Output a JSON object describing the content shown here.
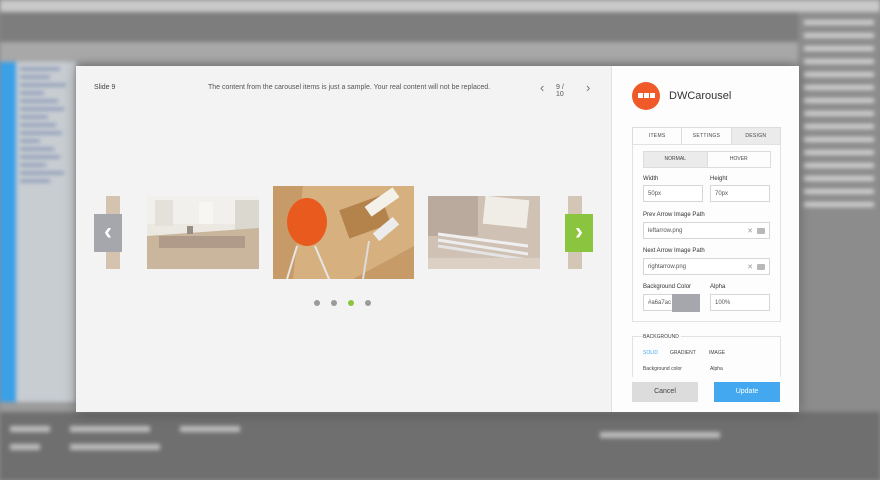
{
  "dialog": {
    "slide_label": "Slide 9",
    "notice": "The content from the carousel items is just a sample. Your real content will not be replaced.",
    "pager": {
      "count": "9 / 10",
      "prev": "‹",
      "next": "›"
    },
    "arrow_prev": "‹",
    "arrow_next": "›",
    "dots": {
      "total": 4,
      "active": 3
    }
  },
  "panel": {
    "title": "DWCarousel",
    "tabs": [
      "ITEMS",
      "SETTINGS",
      "DESIGN"
    ],
    "subtabs": [
      "NORMAL",
      "HOVER"
    ],
    "width_label": "Width",
    "width_value": "50px",
    "height_label": "Height",
    "height_value": "70px",
    "prev_label": "Prev Arrow Image Path",
    "prev_value": "leftarrow.png",
    "next_label": "Next Arrow Image Path",
    "next_value": "rightarrow.png",
    "clear_icon": "✕",
    "bg_color_label": "Background Color",
    "bg_color_value": "#a6a7ac",
    "alpha_label": "Alpha",
    "alpha_value": "100%",
    "background_heading": "BACKGROUND",
    "bg_types": [
      "SOLID",
      "GRADIENT",
      "IMAGE"
    ],
    "cut_off_left": "Background color",
    "cut_off_right": "Alpha",
    "cancel_label": "Cancel",
    "update_label": "Update"
  },
  "colors": {
    "accent_green": "#8bc53f",
    "arrow_gray": "#a6a7ac",
    "logo_orange": "#f05a28",
    "update_blue": "#44a8f0"
  }
}
